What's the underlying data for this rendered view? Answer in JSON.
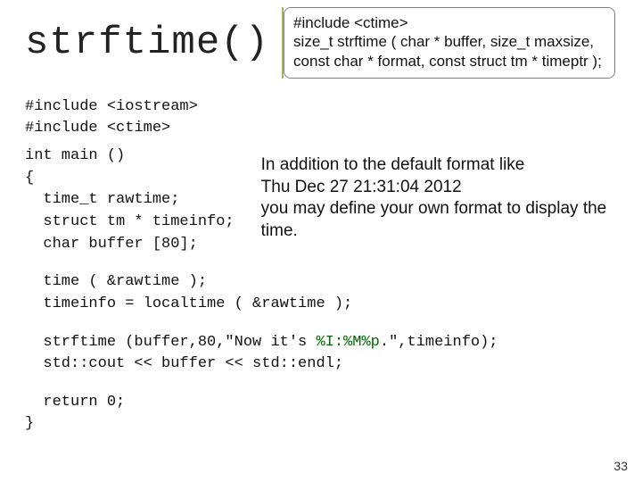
{
  "title": "strftime()",
  "signature": {
    "line1": "#include <ctime>",
    "line2": "size_t strftime ( char * buffer, size_t maxsize, const char * format, const struct tm * timeptr );"
  },
  "code_block1": "#include <iostream>\n#include <ctime>",
  "code_block2": "int main ()\n{\n  time_t rawtime;\n  struct tm * timeinfo;\n  char buffer [80];",
  "note": {
    "l1": "In addition to the default format like",
    "l2": "Thu Dec 27 21:31:04 2012",
    "l3": "you may define your own format to display the time."
  },
  "code_block3": "  time ( &rawtime );\n  timeinfo = localtime ( &rawtime );",
  "code_block4_pre": "  strftime (buffer,80,\"Now it's ",
  "code_block4_fmt": "%I:%M%p",
  "code_block4_post": ".\",timeinfo);\n  std::cout << buffer << std::endl;",
  "code_block5": "  return 0;\n}",
  "page_number": "33"
}
